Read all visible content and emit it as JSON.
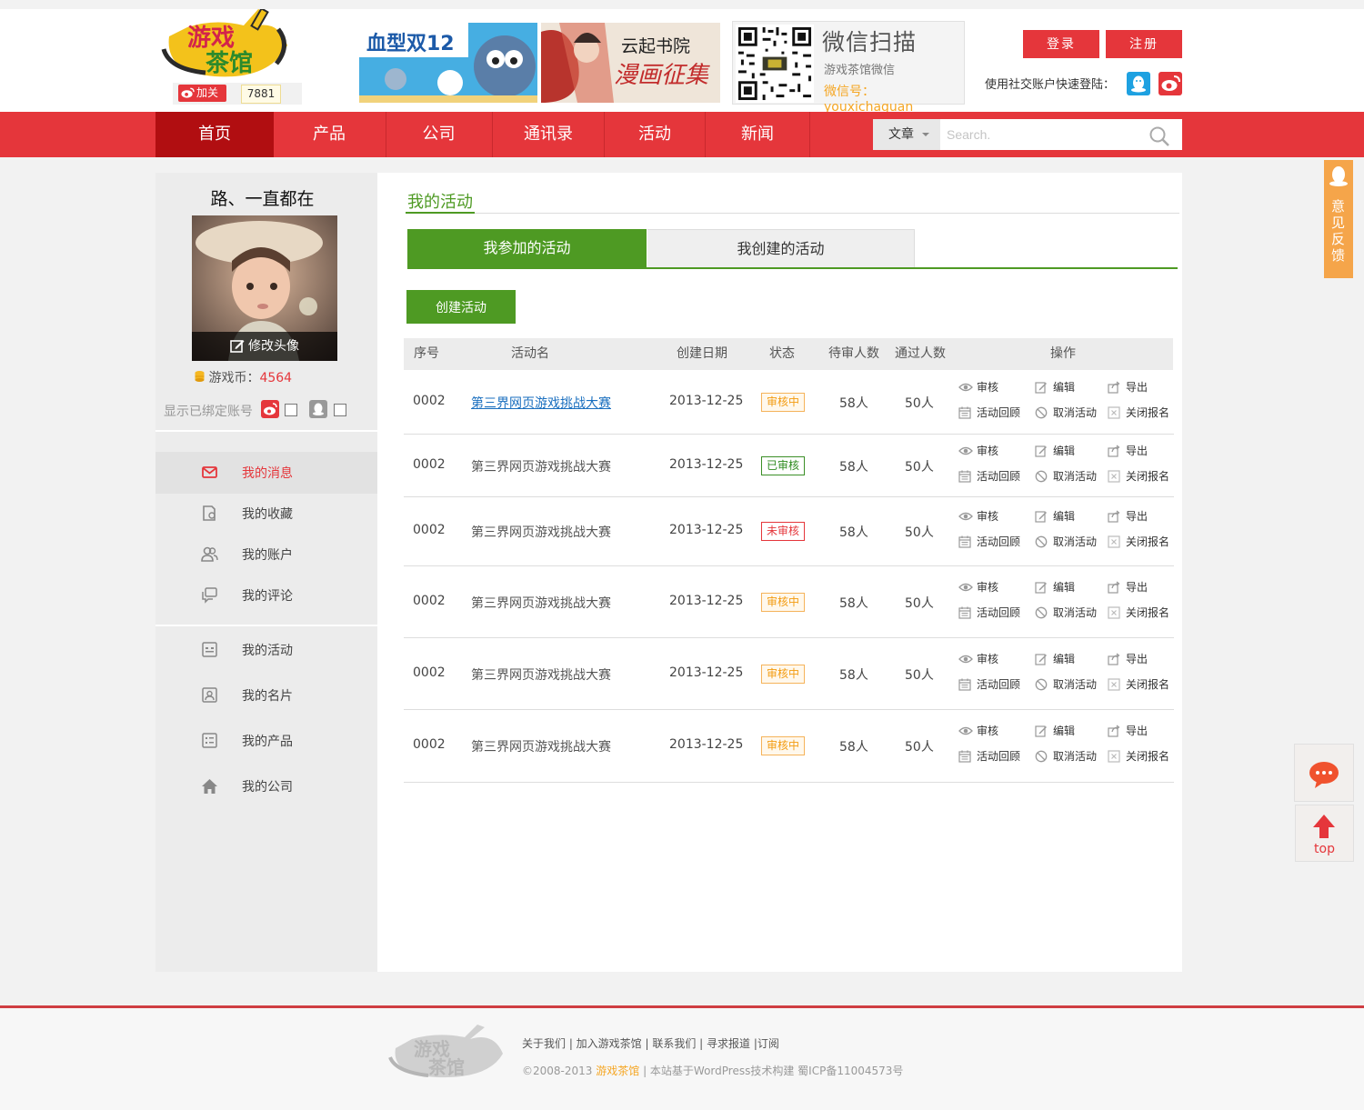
{
  "header": {
    "follow_label": "加关注",
    "follow_count": "7881",
    "logo_text_1": "游戏",
    "logo_text_2": "茶馆",
    "banner1_text": "血型双12",
    "banner2_title": "云起书院",
    "banner2_sub": "漫画征集",
    "qr": {
      "title": "微信扫描",
      "subtitle": "游戏茶馆微信",
      "account": "微信号：youxichaguan"
    },
    "login": "登录",
    "register": "注册",
    "social_label": "使用社交账户快速登陆："
  },
  "nav": {
    "items": [
      "首页",
      "产品",
      "公司",
      "通讯录",
      "活动",
      "新闻"
    ],
    "search_category": "文章",
    "search_placeholder": "Search."
  },
  "sidebar": {
    "username": "路、一直都在",
    "avatar_edit": "修改头像",
    "coin_label": "游戏币：",
    "coin_value": "4564",
    "bind_label": "显示已绑定账号",
    "menu": [
      {
        "label": "我的消息",
        "icon": "envelope-icon"
      },
      {
        "label": "我的收藏",
        "icon": "bookmark-icon"
      },
      {
        "label": "我的账户",
        "icon": "users-icon"
      },
      {
        "label": "我的评论",
        "icon": "comment-icon"
      },
      {
        "label": "我的活动",
        "icon": "activity-icon"
      },
      {
        "label": "我的名片",
        "icon": "card-icon"
      },
      {
        "label": "我的产品",
        "icon": "product-icon"
      },
      {
        "label": "我的公司",
        "icon": "home-icon"
      }
    ]
  },
  "main": {
    "title": "我的活动",
    "tabs": [
      "我参加的活动",
      "我创建的活动"
    ],
    "create_button": "创建活动",
    "columns": [
      "序号",
      "活动名",
      "创建日期",
      "状态",
      "待审人数",
      "通过人数",
      "操作"
    ],
    "ops": [
      "审核",
      "编辑",
      "导出",
      "活动回顾",
      "取消活动",
      "关闭报名"
    ],
    "rows": [
      {
        "id": "0002",
        "name": "第三界网页游戏挑战大赛",
        "date": "2013-12-25",
        "status": "审核中",
        "pending": "58人",
        "passed": "50人"
      },
      {
        "id": "0002",
        "name": "第三界网页游戏挑战大赛",
        "date": "2013-12-25",
        "status": "已审核",
        "pending": "58人",
        "passed": "50人"
      },
      {
        "id": "0002",
        "name": "第三界网页游戏挑战大赛",
        "date": "2013-12-25",
        "status": "未审核",
        "pending": "58人",
        "passed": "50人"
      },
      {
        "id": "0002",
        "name": "第三界网页游戏挑战大赛",
        "date": "2013-12-25",
        "status": "审核中",
        "pending": "58人",
        "passed": "50人"
      },
      {
        "id": "0002",
        "name": "第三界网页游戏挑战大赛",
        "date": "2013-12-25",
        "status": "审核中",
        "pending": "58人",
        "passed": "50人"
      },
      {
        "id": "0002",
        "name": "第三界网页游戏挑战大赛",
        "date": "2013-12-25",
        "status": "审核中",
        "pending": "58人",
        "passed": "50人"
      }
    ]
  },
  "floating": {
    "feedback": "意见反馈",
    "top": "top"
  },
  "footer": {
    "links": "关于我们 | 加入游戏茶馆 | 联系我们 | 寻求报道 |订阅",
    "copy_prefix": "©2008-2013 ",
    "copy_brand": "游戏茶馆",
    "copy_suffix": " | 本站基于WordPress技术构建    蜀ICP备11004573号"
  },
  "colors": {
    "brand_red": "#e5363b",
    "nav_active": "#b10e11",
    "accent_green": "#4e9a23",
    "pending": "#f39c12",
    "feedback_orange": "#f5a54a"
  }
}
